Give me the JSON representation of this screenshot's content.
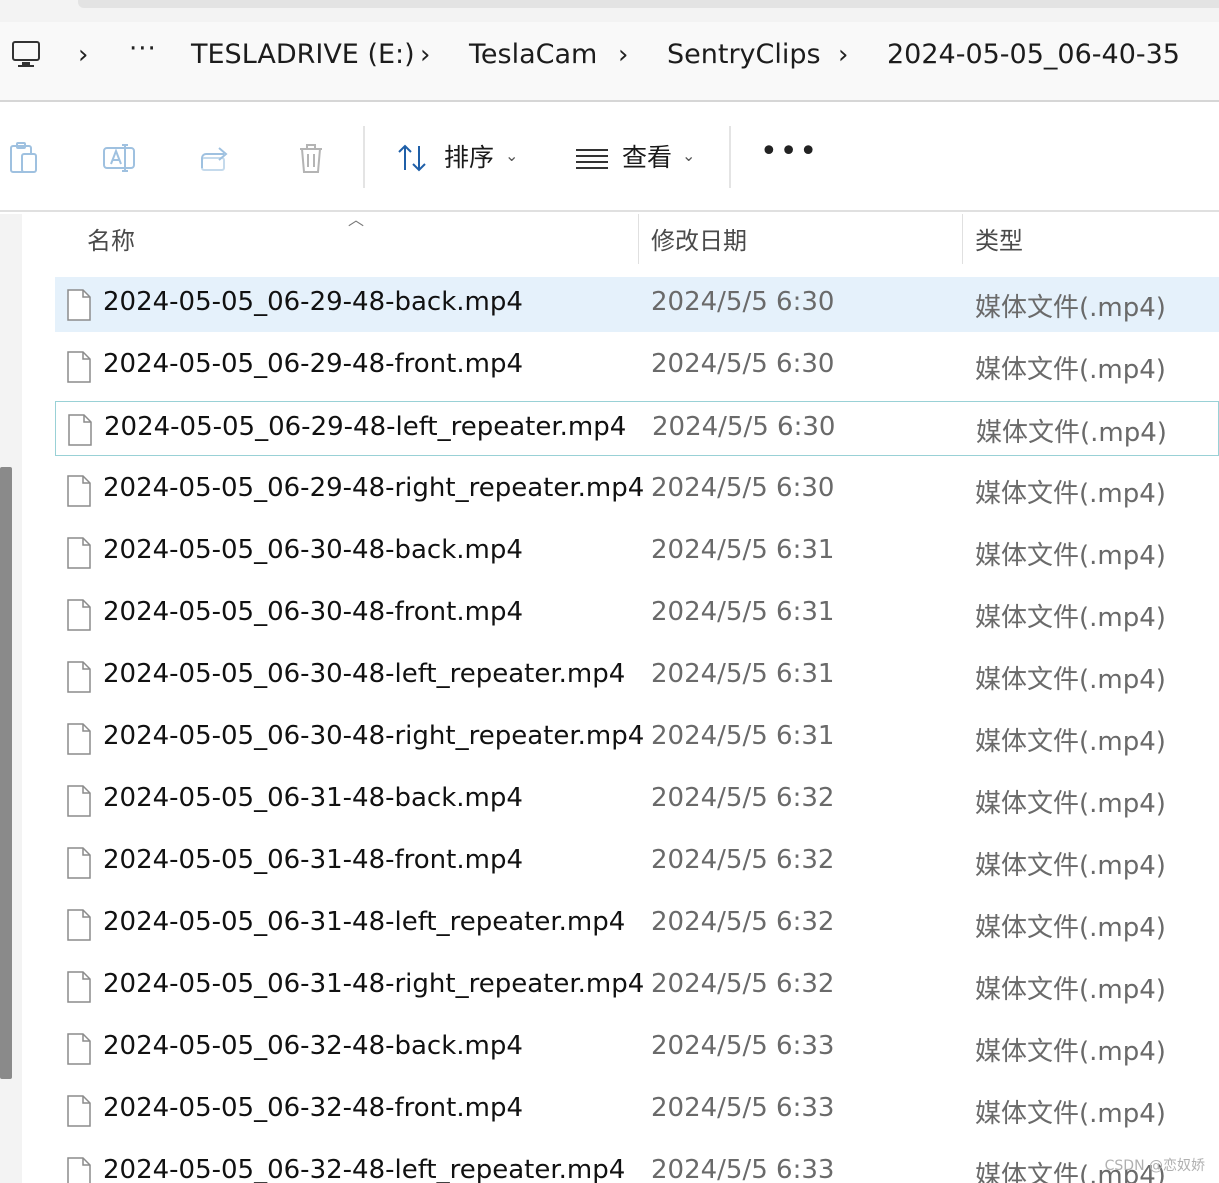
{
  "breadcrumb": {
    "items": [
      "TESLADRIVE (E:)",
      "TeslaCam",
      "SentryClips",
      "2024-05-05_06-40-35"
    ]
  },
  "toolbar": {
    "sort_label": "排序",
    "view_label": "查看"
  },
  "columns": {
    "name": "名称",
    "date": "修改日期",
    "type": "类型"
  },
  "files": [
    {
      "name": "2024-05-05_06-29-48-back.mp4",
      "date": "2024/5/5 6:30",
      "type": "媒体文件(.mp4)",
      "selected": true
    },
    {
      "name": "2024-05-05_06-29-48-front.mp4",
      "date": "2024/5/5 6:30",
      "type": "媒体文件(.mp4)"
    },
    {
      "name": "2024-05-05_06-29-48-left_repeater.mp4",
      "date": "2024/5/5 6:30",
      "type": "媒体文件(.mp4)",
      "focused": true
    },
    {
      "name": "2024-05-05_06-29-48-right_repeater.mp4",
      "date": "2024/5/5 6:30",
      "type": "媒体文件(.mp4)"
    },
    {
      "name": "2024-05-05_06-30-48-back.mp4",
      "date": "2024/5/5 6:31",
      "type": "媒体文件(.mp4)"
    },
    {
      "name": "2024-05-05_06-30-48-front.mp4",
      "date": "2024/5/5 6:31",
      "type": "媒体文件(.mp4)"
    },
    {
      "name": "2024-05-05_06-30-48-left_repeater.mp4",
      "date": "2024/5/5 6:31",
      "type": "媒体文件(.mp4)"
    },
    {
      "name": "2024-05-05_06-30-48-right_repeater.mp4",
      "date": "2024/5/5 6:31",
      "type": "媒体文件(.mp4)"
    },
    {
      "name": "2024-05-05_06-31-48-back.mp4",
      "date": "2024/5/5 6:32",
      "type": "媒体文件(.mp4)"
    },
    {
      "name": "2024-05-05_06-31-48-front.mp4",
      "date": "2024/5/5 6:32",
      "type": "媒体文件(.mp4)"
    },
    {
      "name": "2024-05-05_06-31-48-left_repeater.mp4",
      "date": "2024/5/5 6:32",
      "type": "媒体文件(.mp4)"
    },
    {
      "name": "2024-05-05_06-31-48-right_repeater.mp4",
      "date": "2024/5/5 6:32",
      "type": "媒体文件(.mp4)"
    },
    {
      "name": "2024-05-05_06-32-48-back.mp4",
      "date": "2024/5/5 6:33",
      "type": "媒体文件(.mp4)"
    },
    {
      "name": "2024-05-05_06-32-48-front.mp4",
      "date": "2024/5/5 6:33",
      "type": "媒体文件(.mp4)"
    },
    {
      "name": "2024-05-05_06-32-48-left_repeater.mp4",
      "date": "2024/5/5 6:33",
      "type": "媒体文件(.mp4)"
    }
  ],
  "watermark": "CSDN @恋奴娇",
  "colors": {
    "selected_row": "#e5f1fb",
    "focus_border": "#99d1d6"
  }
}
